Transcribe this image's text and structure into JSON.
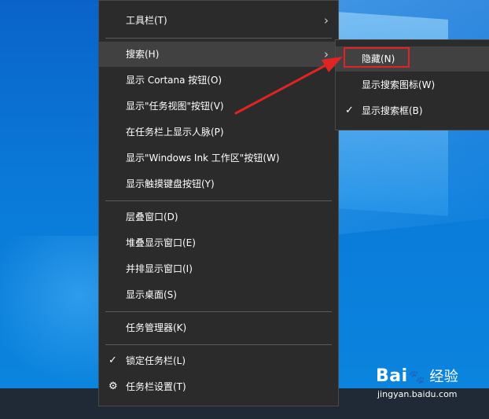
{
  "context_menu": {
    "items": [
      {
        "label": "工具栏(T)",
        "has_submenu": true
      },
      {
        "label": "搜索(H)",
        "has_submenu": true,
        "hovered": true
      },
      {
        "label": "显示 Cortana 按钮(O)"
      },
      {
        "label": "显示\"任务视图\"按钮(V)"
      },
      {
        "label": "在任务栏上显示人脉(P)"
      },
      {
        "label": "显示\"Windows Ink 工作区\"按钮(W)"
      },
      {
        "label": "显示触摸键盘按钮(Y)"
      },
      {
        "label": "层叠窗口(D)"
      },
      {
        "label": "堆叠显示窗口(E)"
      },
      {
        "label": "并排显示窗口(I)"
      },
      {
        "label": "显示桌面(S)"
      },
      {
        "label": "任务管理器(K)"
      },
      {
        "label": "锁定任务栏(L)",
        "checked": true
      },
      {
        "label": "任务栏设置(T)",
        "icon": "gear-icon"
      }
    ],
    "submenu_glyph": "›",
    "check_glyph": "✓",
    "gear_glyph": "⚙"
  },
  "search_submenu": {
    "items": [
      {
        "label": "隐藏(N)",
        "hovered": true,
        "annotated": true
      },
      {
        "label": "显示搜索图标(W)"
      },
      {
        "label": "显示搜索框(B)",
        "checked": true
      }
    ]
  },
  "annotation": {
    "arrow_color": "#e02424",
    "box_color": "#e02424"
  },
  "watermark": {
    "brand_left": "Bai",
    "brand_right": "经验",
    "url": "jingyan.baidu.com"
  },
  "colors": {
    "menu_bg": "#2b2b2b",
    "menu_hover": "#414141",
    "desktop_blue": "#0a7ad8"
  }
}
